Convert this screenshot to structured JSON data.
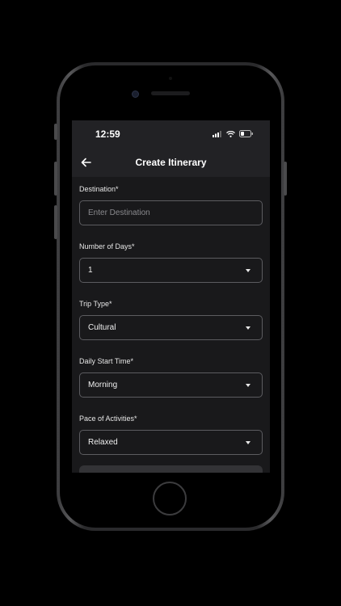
{
  "status_bar": {
    "time": "12:59"
  },
  "header": {
    "title": "Create Itinerary"
  },
  "form": {
    "destination": {
      "label": "Destination*",
      "placeholder": "Enter Destination"
    },
    "days": {
      "label": "Number of Days*",
      "value": "1"
    },
    "trip_type": {
      "label": "Trip Type*",
      "value": "Cultural"
    },
    "start_time": {
      "label": "Daily Start Time*",
      "value": "Morning"
    },
    "pace": {
      "label": "Pace of Activities*",
      "value": "Relaxed"
    }
  },
  "icons": {
    "back": "arrow-left-icon",
    "signal": "cellular-signal-icon",
    "wifi": "wifi-icon",
    "battery": "battery-icon",
    "dropdown": "caret-down-icon"
  },
  "colors": {
    "screen_bg": "#19191b",
    "header_bg": "#222225",
    "field_border": "#5c5c60",
    "text": "#ffffff",
    "placeholder": "#8a8a8e"
  }
}
